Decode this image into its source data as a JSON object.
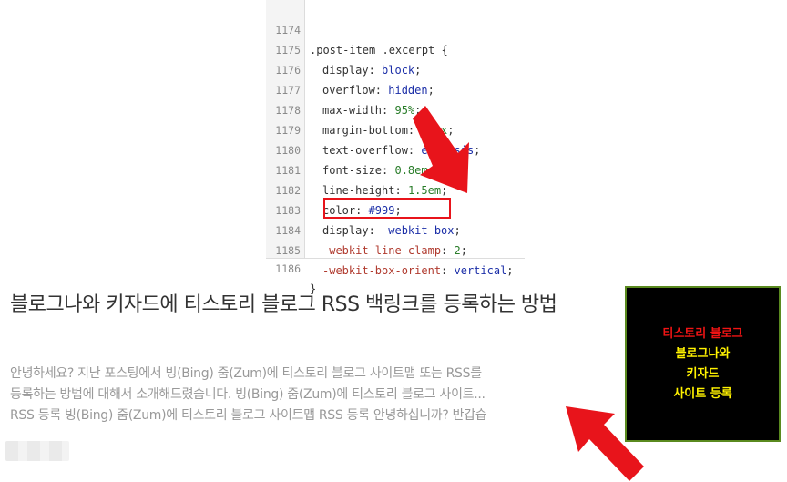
{
  "code": {
    "lines": [
      {
        "num": "1174",
        "text": ".post-item .excerpt {"
      },
      {
        "num": "1175",
        "prop": "display",
        "value": "block"
      },
      {
        "num": "1176",
        "prop": "overflow",
        "value": "hidden"
      },
      {
        "num": "1177",
        "prop": "max-width",
        "value": "95%"
      },
      {
        "num": "1178",
        "prop": "margin-bottom",
        "value": "15px"
      },
      {
        "num": "1179",
        "prop": "text-overflow",
        "value": "ellipsis"
      },
      {
        "num": "1180",
        "prop": "font-size",
        "value": "0.8em"
      },
      {
        "num": "1181",
        "prop": "line-height",
        "value": "1.5em"
      },
      {
        "num": "1182",
        "prop": "color",
        "value": "#999"
      },
      {
        "num": "1183",
        "prop": "display",
        "value": "-webkit-box"
      },
      {
        "num": "1184",
        "prop_prefix": "-webkit-",
        "prop": "line-clamp",
        "value": "2"
      },
      {
        "num": "1185",
        "prop_prefix": "-webkit-",
        "prop": "box-orient",
        "value": "vertical"
      },
      {
        "num": "1186",
        "text": "}"
      }
    ]
  },
  "post": {
    "title": "블로그나와 키자드에 티스토리 블로그 RSS 백링크를 등록하는 방법",
    "excerpt_lines": [
      "안녕하세요? 지난 포스팅에서 빙(Bing) 줌(Zum)에 티스토리 블로그 사이트맵 또는 RSS를",
      "등록하는 방법에 대해서 소개해드렸습니다. 빙(Bing) 줌(Zum)에 티스토리 블로그 사이트...",
      "RSS 등록 빙(Bing) 줌(Zum)에 티스토리 블로그 사이트맵 RSS 등록 안녕하십니까? 반갑습"
    ]
  },
  "thumbnail": {
    "line1": "티스토리 블로그",
    "line2": "블로그나와",
    "line3": "키자드",
    "line4": "사이트 등록"
  },
  "colors": {
    "arrow": "#e8141b",
    "highlight_box": "#e8141b",
    "thumb_border": "#5a8a1f"
  },
  "icons": [
    "arrow-down-icon",
    "arrow-up-left-icon"
  ]
}
